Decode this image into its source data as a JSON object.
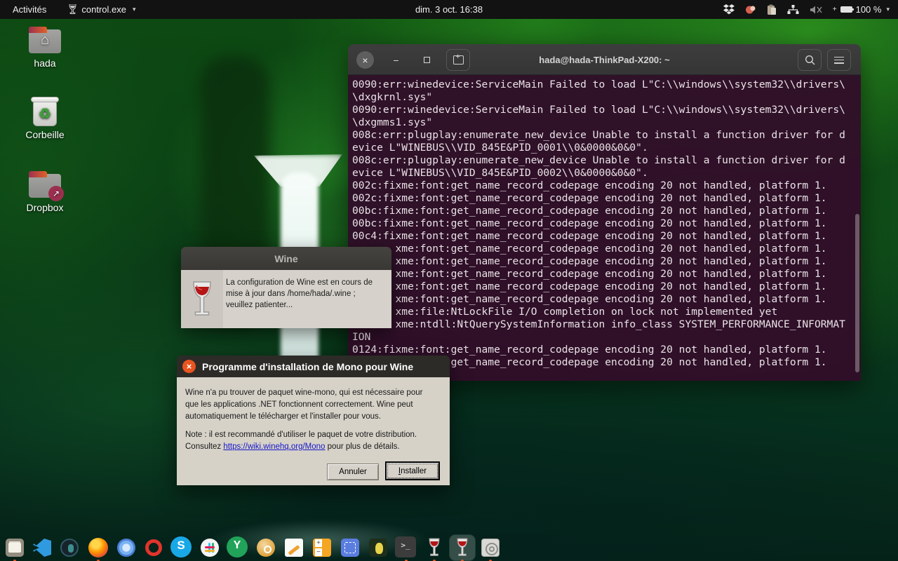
{
  "topbar": {
    "activities_label": "Activités",
    "app_menu_label": "control.exe",
    "clock": "dim. 3 oct.  16:38",
    "battery_label": "100 %",
    "tray_icons": [
      "dropbox-icon",
      "notification-icon",
      "clipboard-icon",
      "network-icon",
      "volume-muted-icon",
      "battery-icon"
    ]
  },
  "desktop": {
    "icons": [
      {
        "label": "hada",
        "icon": "home-folder-icon"
      },
      {
        "label": "Corbeille",
        "icon": "trash-icon"
      },
      {
        "label": "Dropbox",
        "icon": "dropbox-folder-icon"
      }
    ]
  },
  "terminal": {
    "title": "hada@hada-ThinkPad-X200: ~",
    "lines": [
      "0090:err:winedevice:ServiceMain Failed to load L\"C:\\\\windows\\\\system32\\\\drivers\\",
      "\\dxgkrnl.sys\"",
      "0090:err:winedevice:ServiceMain Failed to load L\"C:\\\\windows\\\\system32\\\\drivers\\",
      "\\dxgmms1.sys\"",
      "008c:err:plugplay:enumerate_new_device Unable to install a function driver for d",
      "evice L\"WINEBUS\\\\VID_845E&PID_0001\\\\0&0000&0&0\".",
      "008c:err:plugplay:enumerate_new_device Unable to install a function driver for d",
      "evice L\"WINEBUS\\\\VID_845E&PID_0002\\\\0&0000&0&0\".",
      "002c:fixme:font:get_name_record_codepage encoding 20 not handled, platform 1.",
      "002c:fixme:font:get_name_record_codepage encoding 20 not handled, platform 1.",
      "00bc:fixme:font:get_name_record_codepage encoding 20 not handled, platform 1.",
      "00bc:fixme:font:get_name_record_codepage encoding 20 not handled, platform 1.",
      "00c4:fixme:font:get_name_record_codepage encoding 20 not handled, platform 1.",
      "       xme:font:get_name_record_codepage encoding 20 not handled, platform 1.",
      "       xme:font:get_name_record_codepage encoding 20 not handled, platform 1.",
      "       xme:font:get_name_record_codepage encoding 20 not handled, platform 1.",
      "       xme:font:get_name_record_codepage encoding 20 not handled, platform 1.",
      "       xme:font:get_name_record_codepage encoding 20 not handled, platform 1.",
      "       xme:file:NtLockFile I/O completion on lock not implemented yet",
      "       xme:ntdll:NtQuerySystemInformation info_class SYSTEM_PERFORMANCE_INFORMAT",
      "ION",
      "0124:fixme:font:get_name_record_codepage encoding 20 not handled, platform 1.",
      "                get_name_record_codepage encoding 20 not handled, platform 1."
    ]
  },
  "wine_dialog": {
    "title": "Wine",
    "message_line1": "La configuration de Wine est en cours de",
    "message_line2": "mise à jour dans /home/hada/.wine ;",
    "message_line3": "veuillez patienter..."
  },
  "mono_dialog": {
    "title": "Programme d'installation de Mono pour Wine",
    "close_glyph": "×",
    "para_line1": "Wine n'a pu trouver de paquet wine-mono, qui est nécessaire pour",
    "para_line2": "que les applications .NET fonctionnent correctement. Wine peut",
    "para_line3": "automatiquement le télécharger et l'installer pour vous.",
    "note_line1": "Note : il est recommandé d'utiliser le paquet de votre distribution.",
    "note_prefix": "Consultez ",
    "link_text": "https://wiki.winehq.org/Mono",
    "note_suffix": " pour plus de détails.",
    "cancel_label": "Annuler",
    "install_label": "Installer"
  },
  "dock": {
    "items": [
      {
        "name": "files",
        "running": true
      },
      {
        "name": "vscode",
        "running": false
      },
      {
        "name": "dark-circle-app",
        "running": false
      },
      {
        "name": "firefox",
        "running": true
      },
      {
        "name": "chromium",
        "running": false
      },
      {
        "name": "opera",
        "running": false
      },
      {
        "name": "skype",
        "running": false
      },
      {
        "name": "slack",
        "running": false
      },
      {
        "name": "y-app",
        "running": false
      },
      {
        "name": "backup-tool",
        "running": false
      },
      {
        "name": "text-editor",
        "running": false
      },
      {
        "name": "calculator",
        "running": false
      },
      {
        "name": "screenshot-tool",
        "running": false
      },
      {
        "name": "game-app",
        "running": false
      },
      {
        "name": "terminal",
        "running": true
      },
      {
        "name": "wine-app",
        "running": true
      },
      {
        "name": "wine-control",
        "running": true,
        "focused": true
      },
      {
        "name": "winecfg",
        "running": true
      }
    ],
    "skype_glyph": "S",
    "y_glyph": "Y",
    "term_glyph": ">_"
  },
  "colors": {
    "accent_orange": "#e95420",
    "terminal_bg": "#310e29",
    "topbar_bg": "#121212",
    "dialog_body": "#d6d2c8",
    "link_blue": "#1717c9"
  }
}
